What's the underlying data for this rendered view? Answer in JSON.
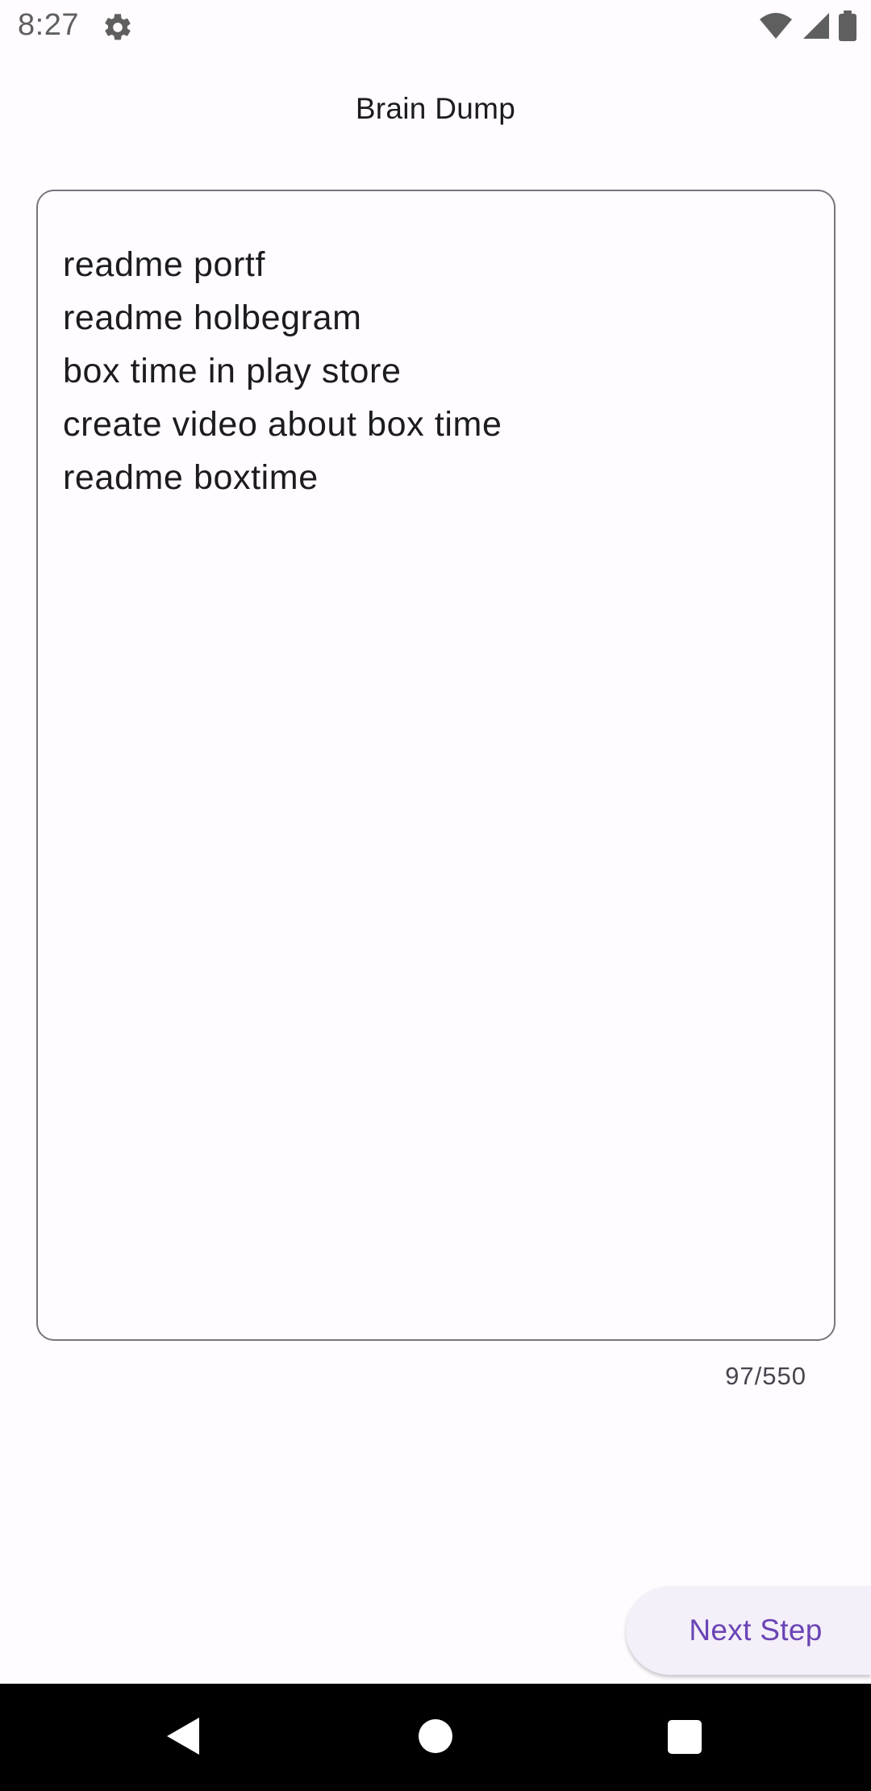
{
  "status_bar": {
    "time": "8:27",
    "icons": [
      "gear-icon",
      "wifi-icon",
      "signal-icon",
      "battery-icon"
    ]
  },
  "app": {
    "title": "Brain Dump"
  },
  "editor": {
    "lines": [
      "readme portf",
      "readme holbegram",
      "box time in play store",
      "create video about box time",
      "readme boxtime"
    ],
    "counter": "97/550"
  },
  "actions": {
    "next_label": "Next Step"
  },
  "colors": {
    "background": "#fffbff",
    "accent": "#6a44b5",
    "button_bg": "#f4eff9",
    "border": "#79747e"
  }
}
